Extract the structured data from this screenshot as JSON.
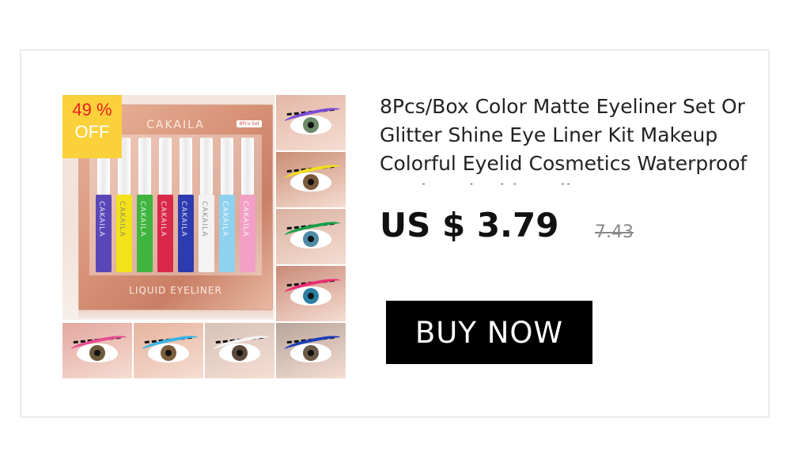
{
  "product": {
    "title": "8Pcs/Box Color Matte Eyeliner Set Or Glitter Shine Eye Liner Kit Makeup Colorful Eyelid Cosmetics Waterproof Lasting Liquid Eyeliner Pen",
    "price": "US $ 3.79",
    "original_price": "7.43",
    "buy_label": "BUY NOW"
  },
  "badge": {
    "percent": "49 %",
    "off": "OFF"
  },
  "gallery": {
    "main_image": {
      "brand": "CAKAILA",
      "set_label": "8Pcs Set",
      "footer": "LIQUID EYELINER",
      "pen_label": "CAKAILA",
      "pens": [
        "#5b46b8",
        "#f2e21a",
        "#3fb43f",
        "#d9284a",
        "#2d3bb0",
        "#f3f3f3",
        "#8fd2ef",
        "#f2a0c4"
      ]
    },
    "thumbnails": [
      {
        "skin": "#e3b7a6",
        "liner": "#7a4bd6",
        "iris": "#6e8a6a",
        "name": "purple-liner"
      },
      {
        "skin": "#c98d74",
        "liner": "#f1df1d",
        "iris": "#7b5a3a",
        "name": "yellow-liner"
      },
      {
        "skin": "#d9b1a0",
        "liner": "#15a04a",
        "iris": "#4f8aa8",
        "name": "green-liner"
      },
      {
        "skin": "#c98a78",
        "liner": "#ea2d74",
        "iris": "#2a7ea1",
        "name": "pink-liner"
      },
      {
        "skin": "#e3a7a0",
        "liner": "#e84c8f",
        "iris": "#6d5a3c",
        "name": "magenta-liner"
      },
      {
        "skin": "#e6b49e",
        "liner": "#37b4e6",
        "iris": "#7a5d3c",
        "name": "blue-liner"
      },
      {
        "skin": "#d7c2b7",
        "liner": "#f4f4f4",
        "iris": "#5d4a3c",
        "name": "white-liner"
      },
      {
        "skin": "#b9a59a",
        "liner": "#1d3fb8",
        "iris": "#6b5a46",
        "name": "navy-liner"
      }
    ]
  }
}
